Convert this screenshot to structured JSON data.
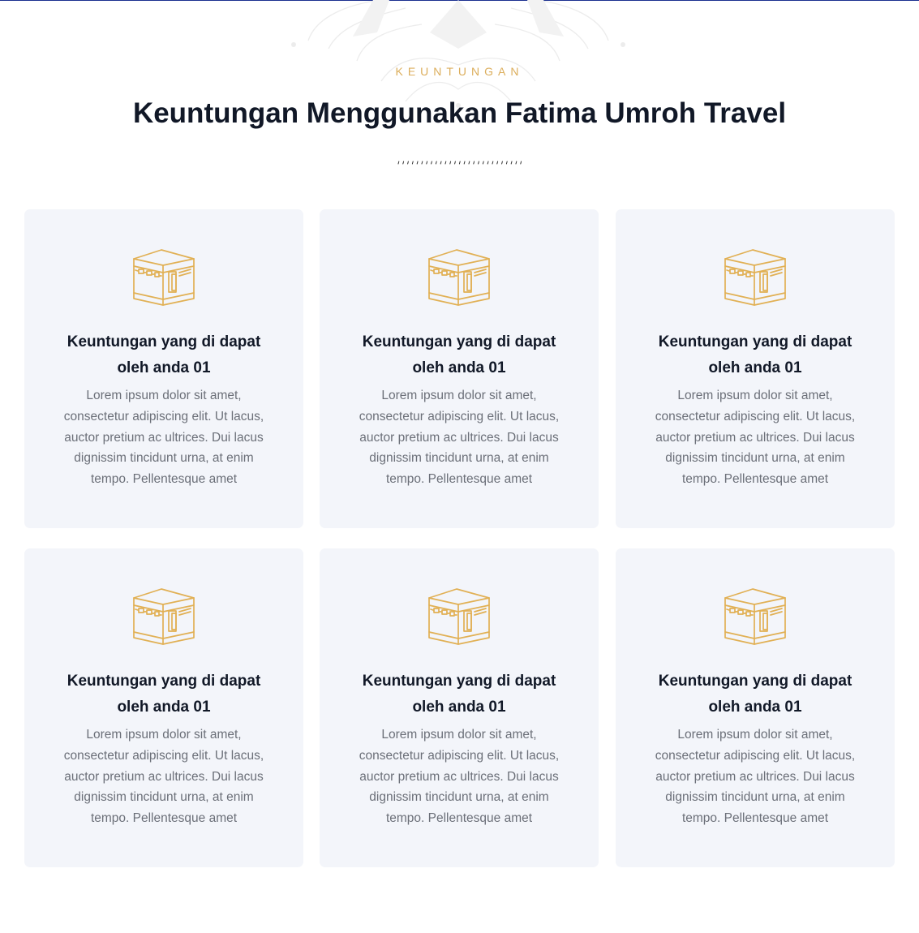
{
  "section": {
    "eyebrow": "KEUNTUNGAN",
    "title": "Keuntungan Menggunakan Fatima Umroh Travel"
  },
  "colors": {
    "accent": "#dcae5c",
    "title": "#111827",
    "body_text": "#6b6f78",
    "card_background": "#f3f5fa",
    "top_line": "#1a2f8f"
  },
  "cards": [
    {
      "icon": "kaaba-icon",
      "title_line1": "Keuntungan yang di dapat",
      "title_line2": "oleh anda 01",
      "text": "Lorem ipsum dolor sit amet, consectetur adipiscing elit. Ut lacus, auctor pretium ac ultrices. Dui lacus dignissim tincidunt urna, at enim tempo. Pellentesque amet"
    },
    {
      "icon": "kaaba-icon",
      "title_line1": "Keuntungan yang di dapat",
      "title_line2": "oleh anda 01",
      "text": "Lorem ipsum dolor sit amet, consectetur adipiscing elit. Ut lacus, auctor pretium ac ultrices. Dui lacus dignissim tincidunt urna, at enim tempo. Pellentesque amet"
    },
    {
      "icon": "kaaba-icon",
      "title_line1": "Keuntungan yang di dapat",
      "title_line2": "oleh anda 01",
      "text": "Lorem ipsum dolor sit amet, consectetur adipiscing elit. Ut lacus, auctor pretium ac ultrices. Dui lacus dignissim tincidunt urna, at enim tempo. Pellentesque amet"
    },
    {
      "icon": "kaaba-icon",
      "title_line1": "Keuntungan yang di dapat",
      "title_line2": "oleh anda 01",
      "text": "Lorem ipsum dolor sit amet, consectetur adipiscing elit. Ut lacus, auctor pretium ac ultrices. Dui lacus dignissim tincidunt urna, at enim tempo. Pellentesque amet"
    },
    {
      "icon": "kaaba-icon",
      "title_line1": "Keuntungan yang di dapat",
      "title_line2": "oleh anda 01",
      "text": "Lorem ipsum dolor sit amet, consectetur adipiscing elit. Ut lacus, auctor pretium ac ultrices. Dui lacus dignissim tincidunt urna, at enim tempo. Pellentesque amet"
    },
    {
      "icon": "kaaba-icon",
      "title_line1": "Keuntungan yang di dapat",
      "title_line2": "oleh anda 01",
      "text": "Lorem ipsum dolor sit amet, consectetur adipiscing elit. Ut lacus, auctor pretium ac ultrices. Dui lacus dignissim tincidunt urna, at enim tempo. Pellentesque amet"
    }
  ]
}
